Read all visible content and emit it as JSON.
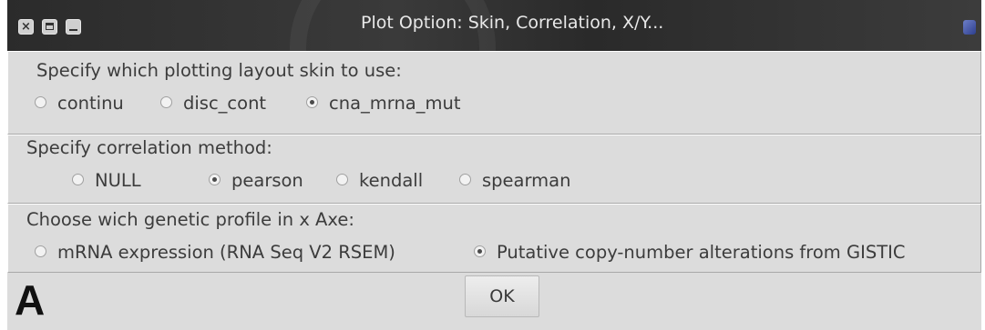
{
  "window": {
    "title": "Plot Option: Skin, Correlation, X/Y...",
    "close_glyph": "×"
  },
  "skin": {
    "heading": "Specify which plotting layout skin to use:",
    "options": [
      {
        "label": "continu",
        "selected": false
      },
      {
        "label": "disc_cont",
        "selected": false
      },
      {
        "label": "cna_mrna_mut",
        "selected": true
      }
    ]
  },
  "correlation": {
    "heading": "Specify correlation method:",
    "options": [
      {
        "label": "NULL",
        "selected": false
      },
      {
        "label": "pearson",
        "selected": true
      },
      {
        "label": "kendall",
        "selected": false
      },
      {
        "label": "spearman",
        "selected": false
      }
    ]
  },
  "profile": {
    "heading": "Choose wich genetic profile in x Axe:",
    "options": [
      {
        "label": "mRNA expression (RNA Seq V2 RSEM)",
        "selected": false
      },
      {
        "label": "Putative copy-number alterations from GISTIC",
        "selected": true
      }
    ]
  },
  "actions": {
    "ok_label": "OK"
  },
  "figure_label": "A",
  "colors": {
    "titlebar": "#2b2b2b",
    "panel": "#dcdcdc",
    "text": "#3c3c3c"
  }
}
